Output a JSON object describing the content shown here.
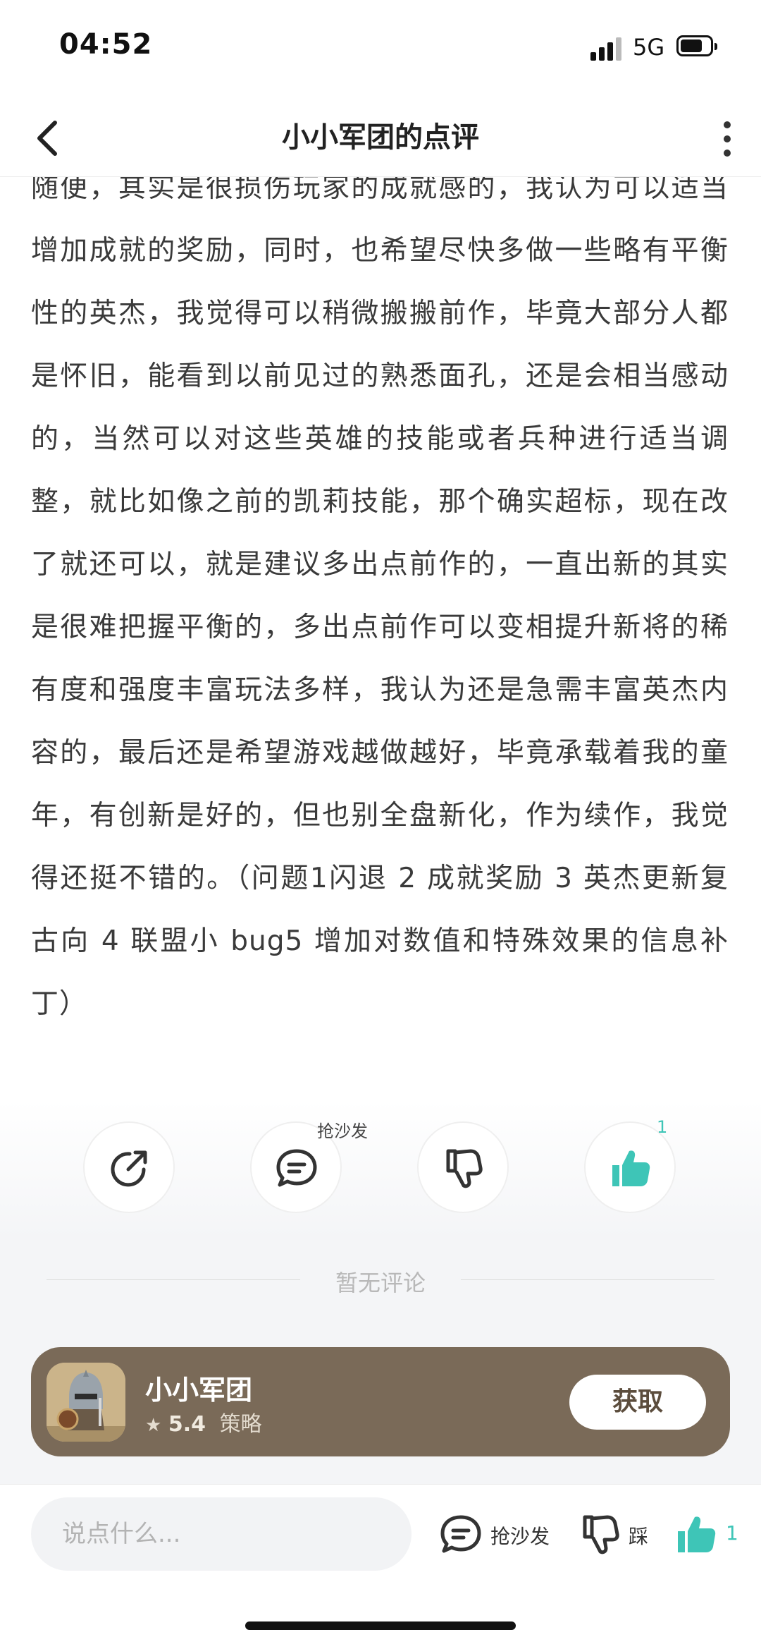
{
  "status_bar": {
    "time": "04:52",
    "network": "5G"
  },
  "nav": {
    "title": "小小军团的点评"
  },
  "review": {
    "text": "随便，其实是很损伤玩家的成就感的，我认为可以适当增加成就的奖励，同时，也希望尽快多做一些略有平衡性的英杰，我觉得可以稍微搬搬前作，毕竟大部分人都是怀旧，能看到以前见过的熟悉面孔，还是会相当感动的，当然可以对这些英雄的技能或者兵种进行适当调整，就比如像之前的凯莉技能，那个确实超标，现在改了就还可以，就是建议多出点前作的，一直出新的其实是很难把握平衡的，多出点前作可以变相提升新将的稀有度和强度丰富玩法多样，我认为还是急需丰富英杰内容的，最后还是希望游戏越做越好，毕竟承载着我的童年，有创新是好的，但也别全盘新化，作为续作，我觉得还挺不错的。（问题1闪退 2 成就奖励 3 英杰更新复古向 4 联盟小 bug5 增加对数值和特殊效果的信息补丁）"
  },
  "actions": {
    "share_icon": "share-icon",
    "comment_badge": "抢沙发",
    "like_count": "1"
  },
  "comments": {
    "empty_text": "暂无评论"
  },
  "game": {
    "name": "小小军团",
    "star": "★",
    "rating": "5.4",
    "genre": "策略",
    "get_label": "获取"
  },
  "bottom_bar": {
    "input_placeholder": "说点什么...",
    "comment_label": "抢沙发",
    "dislike_label": "踩",
    "like_count": "1"
  },
  "colors": {
    "accent_teal": "#3ec5b7",
    "card_brown": "#7a6a58",
    "text": "#3a3a3a"
  }
}
